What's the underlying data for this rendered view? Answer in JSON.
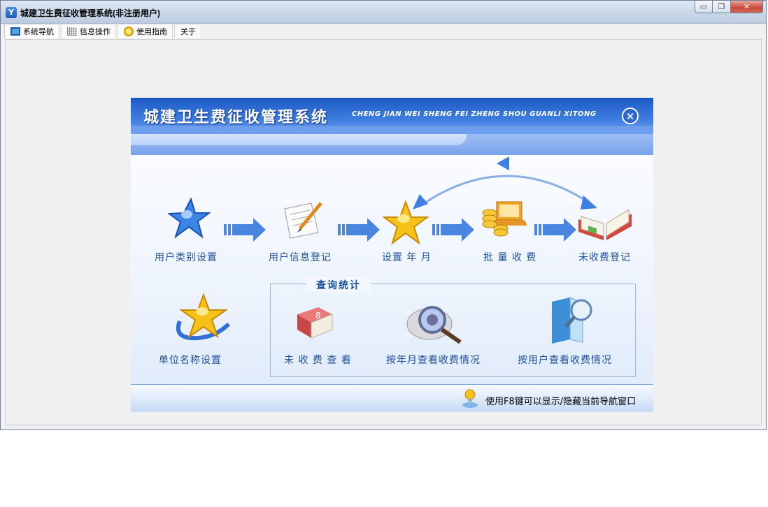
{
  "window": {
    "title": "城建卫生费征收管理系统(非注册用户)",
    "app_icon": "app-logo-icon",
    "buttons": {
      "minimize": "minimize-icon",
      "maximize": "restore-icon",
      "close": "close-icon"
    }
  },
  "menu": [
    {
      "label": "系统导航",
      "icon": "monitor-icon"
    },
    {
      "label": "信息操作",
      "icon": "grid-icon"
    },
    {
      "label": "使用指南",
      "icon": "help-icon"
    },
    {
      "label": "关于",
      "icon": ""
    }
  ],
  "panel": {
    "title": "城建卫生费征收管理系统",
    "subtitle": "CHENG JIAN WEI SHENG FEI ZHENG SHOU GUANLI XITONG",
    "close_icon": "close-circle-icon",
    "workflow": [
      {
        "label": "用户类别设置",
        "icon": "blue-star-icon"
      },
      {
        "label": "用户信息登记",
        "icon": "notepad-pencil-icon"
      },
      {
        "label": "设置 年 月",
        "icon": "gold-star-icon"
      },
      {
        "label": "批 量 收 费",
        "icon": "coins-laptop-icon"
      },
      {
        "label": "未收费登记",
        "icon": "open-book-icon"
      }
    ],
    "unit_setting": {
      "label": "单位名称设置",
      "icon": "star-orbit-icon"
    },
    "query": {
      "title": "查询统计",
      "items": [
        {
          "label": "未 收 费 查 看",
          "icon": "red-book-icon"
        },
        {
          "label": "按年月查看收费情况",
          "icon": "magnifier-disc-icon"
        },
        {
          "label": "按用户查看收费情况",
          "icon": "folder-magnifier-icon"
        }
      ]
    },
    "footer_tip": "使用F8键可以显示/隐藏当前导航窗口",
    "footer_icon": "user-bulb-icon"
  },
  "colors": {
    "accent": "#1c58c4",
    "label_text": "#1c4f9c",
    "arrow": "#3d7fe3"
  }
}
